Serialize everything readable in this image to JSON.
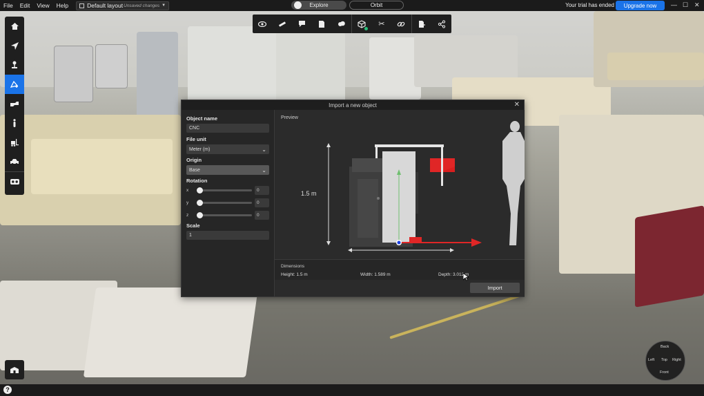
{
  "menubar": {
    "items": [
      "File",
      "Edit",
      "View",
      "Help"
    ]
  },
  "layout": {
    "name": "Default layout",
    "status": "Unsaved changes"
  },
  "modes": {
    "explore": "Explore",
    "orbit": "Orbit"
  },
  "trial": {
    "message": "Your trial has ended",
    "upgrade_label": "Upgrade now"
  },
  "toolbar_icons": [
    "eye-icon",
    "measure-icon",
    "annotation-icon",
    "document-icon",
    "cloud-icon",
    "cube-icon",
    "scissors-icon",
    "link-icon",
    "export-icon",
    "share-icon"
  ],
  "sidebar_icons": [
    "home-icon",
    "navigate-icon",
    "pin-icon",
    "import-object-icon",
    "hand-icon",
    "person-icon",
    "forklift-icon",
    "car-icon",
    "vr-headset-icon"
  ],
  "dialog": {
    "title": "Import a new object",
    "object_name_label": "Object name",
    "object_name_value": "CNC",
    "file_unit_label": "File unit",
    "file_unit_value": "Meter (m)",
    "origin_label": "Origin",
    "origin_value": "Base",
    "rotation_label": "Rotation",
    "rotation": [
      {
        "axis": "x",
        "value": "0"
      },
      {
        "axis": "y",
        "value": "0"
      },
      {
        "axis": "z",
        "value": "0"
      }
    ],
    "scale_label": "Scale",
    "scale_value": "1",
    "preview_label": "Preview",
    "height_annotation": "1.5 m",
    "dimensions_label": "Dimensions",
    "height": "Height: 1.5 m",
    "width": "Width: 1.589 m",
    "depth": "Depth: 3.012 m",
    "import_label": "Import"
  },
  "compass": {
    "back": "Back",
    "left": "Left",
    "top": "Top",
    "right": "Right",
    "front": "Front"
  },
  "help_label": "?"
}
